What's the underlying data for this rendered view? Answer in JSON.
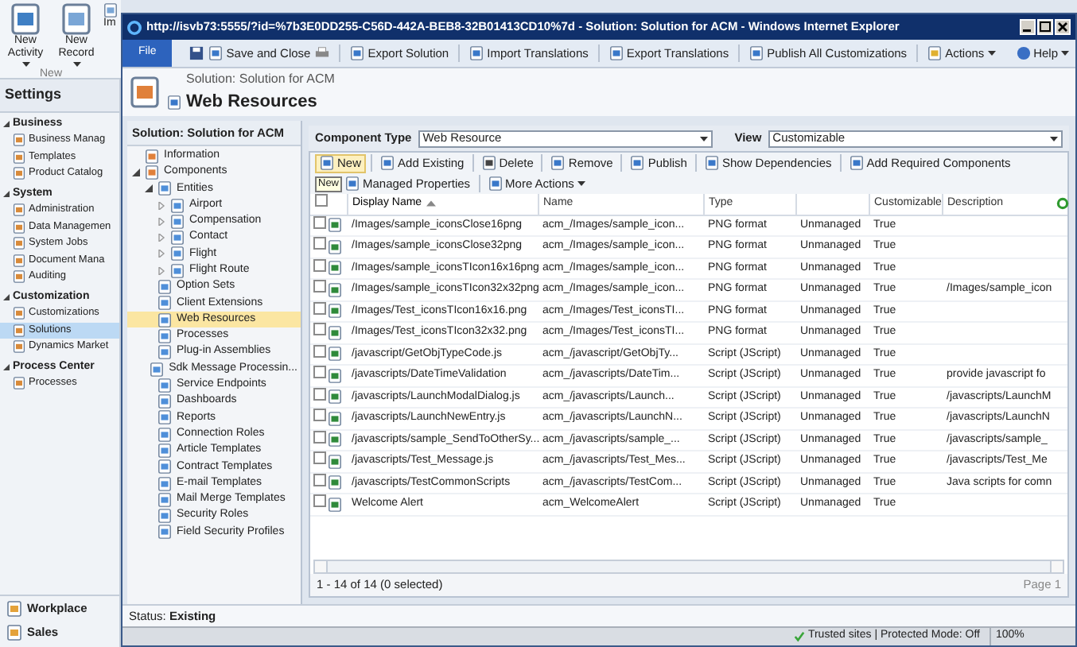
{
  "background": {
    "ribbon": {
      "buttons": [
        {
          "label": "New Activity",
          "caret": true
        },
        {
          "label": "New Record",
          "caret": true
        },
        {
          "label": "Im",
          "caret": false
        }
      ],
      "group": "New"
    },
    "nav": {
      "title": "Settings",
      "groups": [
        {
          "label": "Business",
          "expanded": true,
          "items": [
            {
              "label": "Business Manag",
              "selected": false
            },
            {
              "label": "Templates",
              "selected": false
            },
            {
              "label": "Product Catalog",
              "selected": false
            }
          ]
        },
        {
          "label": "System",
          "expanded": true,
          "items": [
            {
              "label": "Administration",
              "selected": false
            },
            {
              "label": "Data Managemen",
              "selected": false
            },
            {
              "label": "System Jobs",
              "selected": false
            },
            {
              "label": "Document Mana",
              "selected": false
            },
            {
              "label": "Auditing",
              "selected": false
            }
          ]
        },
        {
          "label": "Customization",
          "expanded": true,
          "items": [
            {
              "label": "Customizations",
              "selected": false
            },
            {
              "label": "Solutions",
              "selected": true
            },
            {
              "label": "Dynamics Market",
              "selected": false
            }
          ]
        },
        {
          "label": "Process Center",
          "expanded": true,
          "items": [
            {
              "label": "Processes",
              "selected": false
            }
          ]
        }
      ],
      "bottom": [
        "Workplace",
        "Sales"
      ]
    }
  },
  "window": {
    "title": "http://isvb73:5555/?id=%7b3E0DD255-C56D-442A-BEB8-32B01413CD10%7d - Solution: Solution for ACM - Windows Internet Explorer",
    "toolbar": {
      "file": "File",
      "buttons": [
        {
          "label": "Save and Close",
          "caret": false
        },
        {
          "label": "Export Solution",
          "caret": false
        },
        {
          "label": "Import Translations",
          "caret": false
        },
        {
          "label": "Export Translations",
          "caret": false
        },
        {
          "label": "Publish All Customizations",
          "caret": false
        },
        {
          "label": "Actions",
          "caret": true
        }
      ],
      "help": "Help"
    },
    "header": {
      "subtitle": "Solution: Solution for ACM",
      "title": "Web Resources"
    },
    "tree": {
      "title": "Solution: Solution for ACM",
      "items": [
        {
          "label": "Information",
          "selected": false
        },
        {
          "label": "Components",
          "selected": false,
          "expanded": true,
          "children": [
            {
              "label": "Entities",
              "selected": false,
              "expanded": true,
              "children": [
                {
                  "label": "Airport",
                  "selected": false,
                  "expanded": false
                },
                {
                  "label": "Compensation",
                  "selected": false,
                  "expanded": false
                },
                {
                  "label": "Contact",
                  "selected": false,
                  "expanded": false
                },
                {
                  "label": "Flight",
                  "selected": false,
                  "expanded": false
                },
                {
                  "label": "Flight Route",
                  "selected": false,
                  "expanded": false
                }
              ]
            },
            {
              "label": "Option Sets",
              "selected": false
            },
            {
              "label": "Client Extensions",
              "selected": false
            },
            {
              "label": "Web Resources",
              "selected": true
            },
            {
              "label": "Processes",
              "selected": false
            },
            {
              "label": "Plug-in Assemblies",
              "selected": false
            },
            {
              "label": "Sdk Message Processin...",
              "selected": false
            },
            {
              "label": "Service Endpoints",
              "selected": false
            },
            {
              "label": "Dashboards",
              "selected": false
            },
            {
              "label": "Reports",
              "selected": false
            },
            {
              "label": "Connection Roles",
              "selected": false
            },
            {
              "label": "Article Templates",
              "selected": false
            },
            {
              "label": "Contract Templates",
              "selected": false
            },
            {
              "label": "E-mail Templates",
              "selected": false
            },
            {
              "label": "Mail Merge Templates",
              "selected": false
            },
            {
              "label": "Security Roles",
              "selected": false
            },
            {
              "label": "Field Security Profiles",
              "selected": false
            }
          ]
        }
      ]
    },
    "filters": {
      "component_type": {
        "label": "Component Type",
        "value": "Web Resource"
      },
      "view": {
        "label": "View",
        "value": "Customizable"
      }
    },
    "actions": [
      [
        {
          "label": "New",
          "highlighted": true
        },
        {
          "label": "Add Existing",
          "highlighted": false
        },
        {
          "label": "Delete",
          "highlighted": false
        },
        {
          "label": "Remove",
          "highlighted": false
        },
        {
          "label": "Publish",
          "highlighted": false
        },
        {
          "label": "Show Dependencies",
          "highlighted": false
        },
        {
          "label": "Add Required Components",
          "highlighted": false
        }
      ],
      [
        {
          "label": "Managed Properties",
          "highlighted": false
        },
        {
          "label": "More Actions",
          "highlighted": false,
          "caret": true
        }
      ]
    ],
    "tooltip": "New",
    "grid": {
      "select_all": {
        "checked": false
      },
      "columns": [
        {
          "label": "Display Name",
          "sorted": true
        },
        {
          "label": "Name",
          "sorted": false
        },
        {
          "label": "Type",
          "sorted": false
        },
        {
          "sorted": false
        },
        {
          "label": "Customizable",
          "sorted": false
        },
        {
          "label": "Description",
          "sorted": false
        }
      ],
      "rows": [
        {
          "checked": false,
          "cells": [
            "/Images/sample_iconsClose16png",
            "acm_/Images/sample_icon...",
            "PNG format",
            "Unmanaged",
            "True"
          ]
        },
        {
          "checked": false,
          "cells": [
            "/Images/sample_iconsClose32png",
            "acm_/Images/sample_icon...",
            "PNG format",
            "Unmanaged",
            "True"
          ]
        },
        {
          "checked": false,
          "cells": [
            "/Images/sample_iconsTIcon16x16png",
            "acm_/Images/sample_icon...",
            "PNG format",
            "Unmanaged",
            "True"
          ]
        },
        {
          "checked": false,
          "cells": [
            "/Images/sample_iconsTIcon32x32png",
            "acm_/Images/sample_icon...",
            "PNG format",
            "Unmanaged",
            "True",
            "/Images/sample_icon"
          ]
        },
        {
          "checked": false,
          "cells": [
            "/Images/Test_iconsTIcon16x16.png",
            "acm_/Images/Test_iconsTI...",
            "PNG format",
            "Unmanaged",
            "True"
          ]
        },
        {
          "checked": false,
          "cells": [
            "/Images/Test_iconsTIcon32x32.png",
            "acm_/Images/Test_iconsTI...",
            "PNG format",
            "Unmanaged",
            "True"
          ]
        },
        {
          "checked": false,
          "cells": [
            "/javascript/GetObjTypeCode.js",
            "acm_/javascript/GetObjTy...",
            "Script (JScript)",
            "Unmanaged",
            "True"
          ]
        },
        {
          "checked": false,
          "cells": [
            "/javascripts/DateTimeValidation",
            "acm_/javascripts/DateTim...",
            "Script (JScript)",
            "Unmanaged",
            "True",
            "provide javascript fo"
          ]
        },
        {
          "checked": false,
          "cells": [
            "/javascripts/LaunchModalDialog.js",
            "acm_/javascripts/Launch...",
            "Script (JScript)",
            "Unmanaged",
            "True",
            "/javascripts/LaunchM"
          ]
        },
        {
          "checked": false,
          "cells": [
            "/javascripts/LaunchNewEntry.js",
            "acm_/javascripts/LaunchN...",
            "Script (JScript)",
            "Unmanaged",
            "True",
            "/javascripts/LaunchN"
          ]
        },
        {
          "checked": false,
          "cells": [
            "/javascripts/sample_SendToOtherSy...",
            "acm_/javascripts/sample_...",
            "Script (JScript)",
            "Unmanaged",
            "True",
            "/javascripts/sample_"
          ]
        },
        {
          "checked": false,
          "cells": [
            "/javascripts/Test_Message.js",
            "acm_/javascripts/Test_Mes...",
            "Script (JScript)",
            "Unmanaged",
            "True",
            "/javascripts/Test_Me"
          ]
        },
        {
          "checked": false,
          "cells": [
            "/javascripts/TestCommonScripts",
            "acm_/javascripts/TestCom...",
            "Script (JScript)",
            "Unmanaged",
            "True",
            "Java scripts for comn"
          ]
        },
        {
          "checked": false,
          "cells": [
            "Welcome Alert",
            "acm_WelcomeAlert",
            "Script (JScript)",
            "Unmanaged",
            "True"
          ]
        }
      ],
      "count": "1 - 14 of 14 (0 selected)",
      "page": "Page 1"
    },
    "status": "Status: **Existing**",
    "ie_status": {
      "zone": "Trusted sites | Protected Mode: Off",
      "zoom": "100%"
    }
  }
}
